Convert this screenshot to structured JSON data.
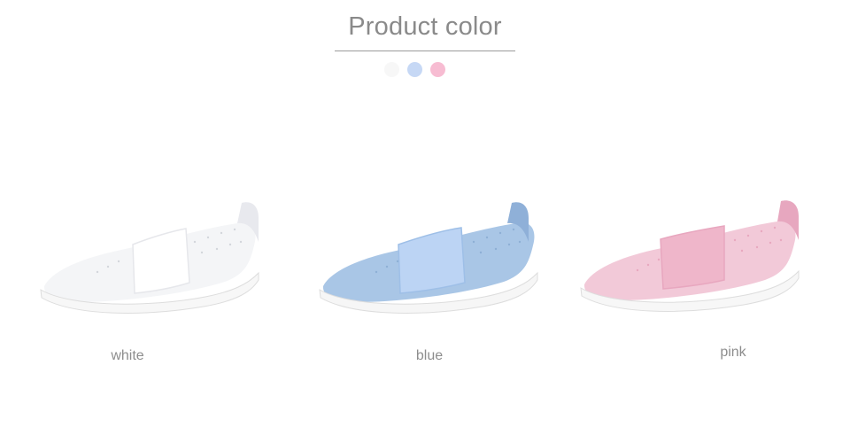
{
  "header": {
    "title": "Product color"
  },
  "swatches": [
    {
      "name": "white",
      "color": "#f7f7f7"
    },
    {
      "name": "blue",
      "color": "#c6d8f5"
    },
    {
      "name": "pink",
      "color": "#f7bcd2"
    }
  ],
  "products": [
    {
      "label": "white",
      "body": "#f4f5f7",
      "band": "#ffffff",
      "accent": "#e8e9ee",
      "sole": "#f7f7f7"
    },
    {
      "label": "blue",
      "body": "#a9c6e6",
      "band": "#bcd4f4",
      "accent": "#8fb0d8",
      "sole": "#f6f6f6"
    },
    {
      "label": "pink",
      "body": "#f2c9d8",
      "band": "#efb6ca",
      "accent": "#e7a7bf",
      "sole": "#f7f7f7"
    }
  ]
}
